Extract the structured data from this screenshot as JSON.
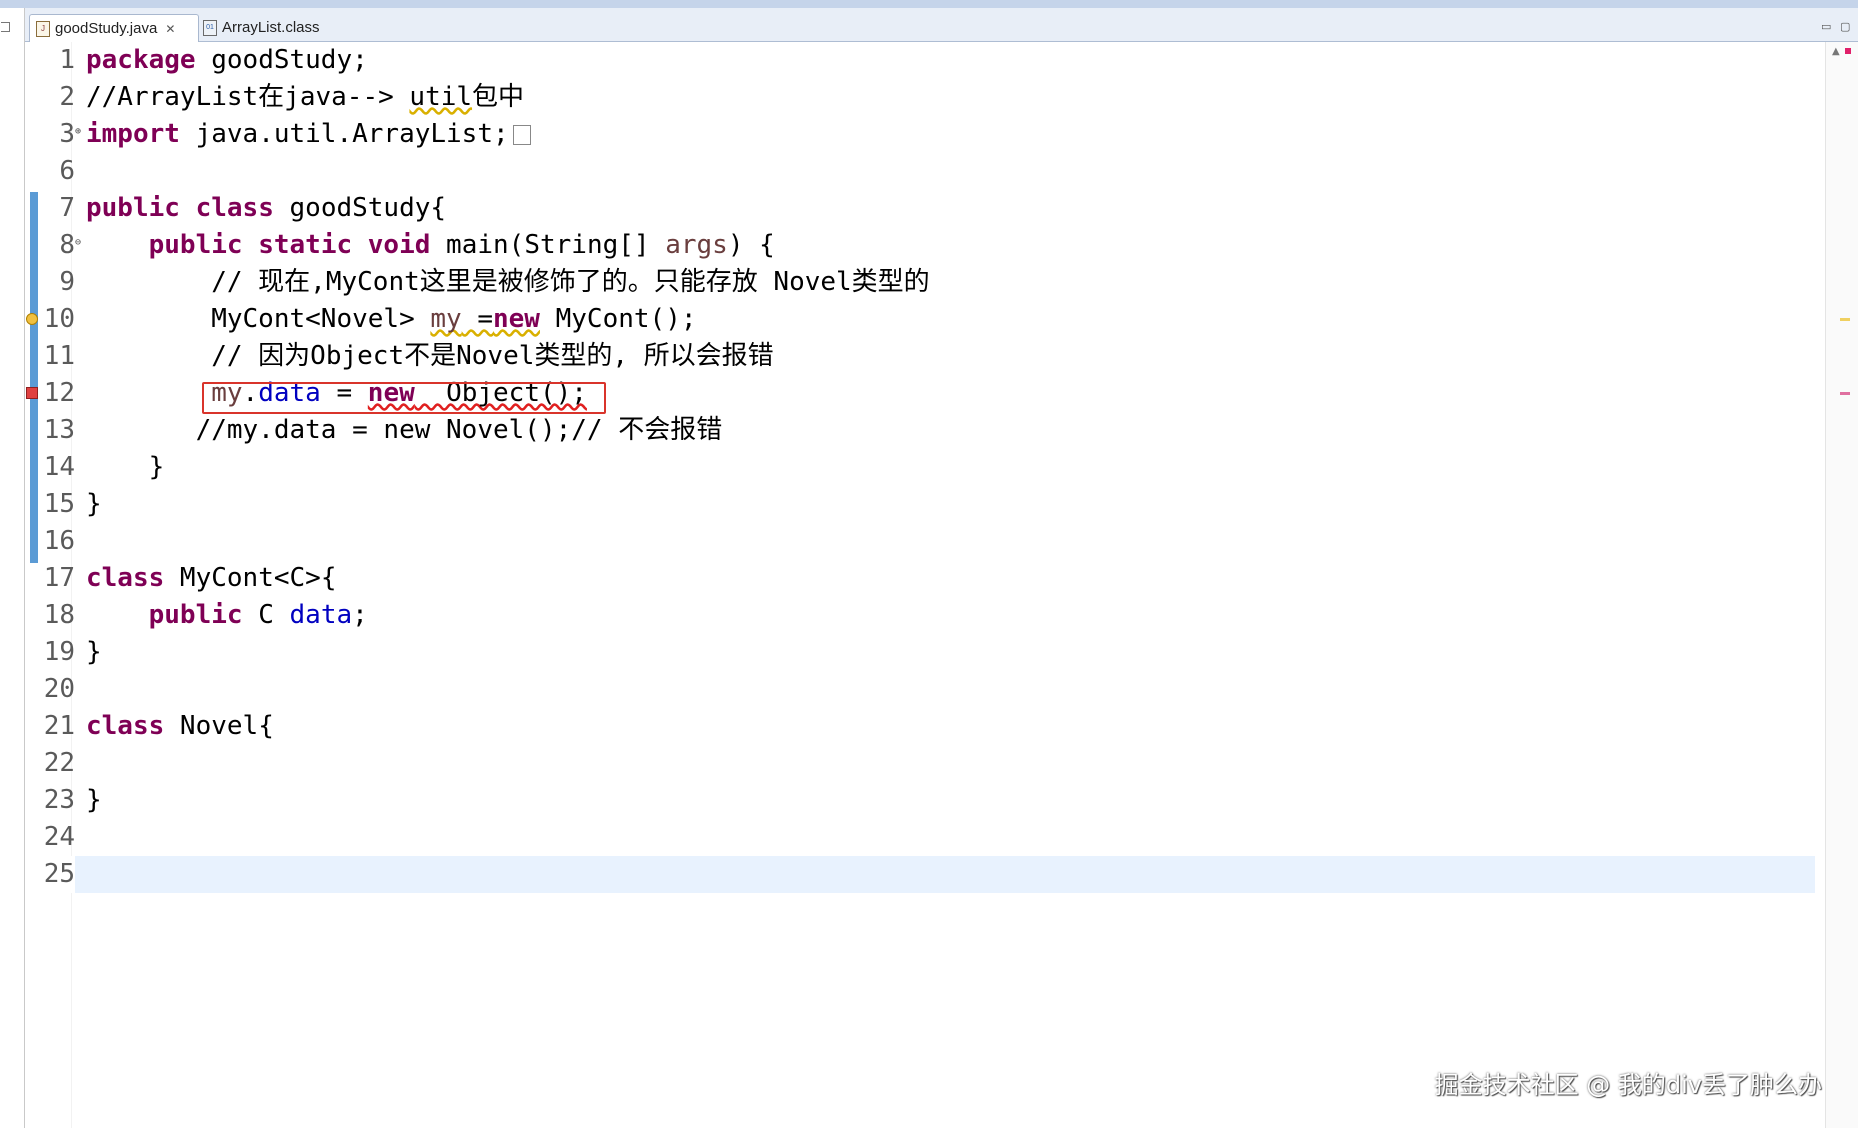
{
  "tabs": [
    {
      "label": "goodStudy.java",
      "active": true,
      "icon": "java-file-icon"
    },
    {
      "label": "ArrayList.class",
      "active": false,
      "icon": "class-file-icon"
    }
  ],
  "window_controls": {
    "minimize": "▭",
    "maximize": "▢"
  },
  "colors": {
    "keyword": "#7f0055",
    "comment": "#3f7f5f",
    "field": "#0000c0",
    "local_variable": "#6a3e3e",
    "highlight_box": "#d9342b",
    "current_line": "#e8f2fe"
  },
  "editor": {
    "lines": [
      {
        "n": "1",
        "parts": {
          "a": "package",
          "b": " goodStudy;"
        }
      },
      {
        "n": "2",
        "parts": {
          "a": "//ArrayList在java--> ",
          "b": "util",
          "c": "包中"
        }
      },
      {
        "n": "3",
        "parts": {
          "a": "import",
          "b": " java.util.ArrayList;"
        }
      },
      {
        "n": "6",
        "parts": {}
      },
      {
        "n": "7",
        "parts": {
          "a": "public",
          "b": " ",
          "c": "class",
          "d": " goodStudy{"
        }
      },
      {
        "n": "8",
        "parts": {
          "a": "    ",
          "b": "public",
          "c": " ",
          "d": "static",
          "e": " ",
          "f": "void",
          "g": " main(String[] ",
          "h": "args",
          "i": ") {"
        }
      },
      {
        "n": "9",
        "parts": {
          "a": "        // 现在,MyCont这里是被修饰了的。只能存放 Novel类型的"
        }
      },
      {
        "n": "10",
        "parts": {
          "a": "        MyCont<Novel> ",
          "b": "my",
          "c": " =",
          "d": "new",
          "e": " MyCont();"
        }
      },
      {
        "n": "11",
        "parts": {
          "a": "        // 因为Object不是Novel类型的, 所以会报错"
        }
      },
      {
        "n": "12",
        "parts": {
          "a": "        ",
          "b": "my",
          "c": ".",
          "d": "data",
          "e": " = ",
          "f": "new",
          "g": "  Object();"
        }
      },
      {
        "n": "13",
        "parts": {
          "a": "       //my.data = new Novel();// 不会报错"
        }
      },
      {
        "n": "14",
        "parts": {
          "a": "    }"
        }
      },
      {
        "n": "15",
        "parts": {
          "a": "}"
        }
      },
      {
        "n": "16",
        "parts": {}
      },
      {
        "n": "17",
        "parts": {
          "a": "class",
          "b": " MyCont<C>{"
        }
      },
      {
        "n": "18",
        "parts": {
          "a": "    ",
          "b": "public",
          "c": " C ",
          "d": "data",
          "e": ";"
        }
      },
      {
        "n": "19",
        "parts": {
          "a": "}"
        }
      },
      {
        "n": "20",
        "parts": {}
      },
      {
        "n": "21",
        "parts": {
          "a": "class",
          "b": " Novel{"
        }
      },
      {
        "n": "22",
        "parts": {}
      },
      {
        "n": "23",
        "parts": {
          "a": "}"
        }
      },
      {
        "n": "24",
        "parts": {}
      },
      {
        "n": "25",
        "parts": {}
      }
    ]
  },
  "watermark": "掘金技术社区 @ 我的div丢了肿么办"
}
